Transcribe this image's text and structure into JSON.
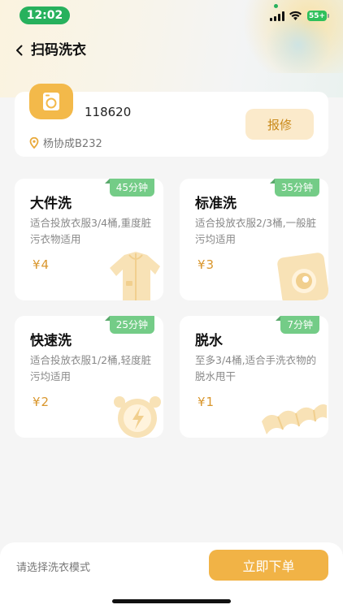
{
  "status_bar": {
    "time": "12:02",
    "battery": "55+"
  },
  "header": {
    "title": "扫码洗衣"
  },
  "device": {
    "id": "118620",
    "location": "杨协成B232",
    "repair_label": "报修"
  },
  "modes": [
    {
      "name": "大件洗",
      "duration": "45分钟",
      "desc": "适合投放衣服3/4桶,重度脏污衣物适用",
      "price": "¥4",
      "icon": "jacket-icon"
    },
    {
      "name": "标准洗",
      "duration": "35分钟",
      "desc": "适合投放衣服2/3桶,一般脏污均适用",
      "price": "¥3",
      "icon": "washing-machine-icon"
    },
    {
      "name": "快速洗",
      "duration": "25分钟",
      "desc": "适合投放衣服1/2桶,轻度脏污均适用",
      "price": "¥2",
      "icon": "alarm-clock-icon"
    },
    {
      "name": "脱水",
      "duration": "7分钟",
      "desc": "至多3/4桶,适合手洗衣物的脱水甩干",
      "price": "¥1",
      "icon": "twisted-towel-icon"
    }
  ],
  "footer": {
    "hint": "请选择洗衣模式",
    "order_label": "立即下单"
  },
  "colors": {
    "accent": "#f1b346",
    "badge": "#74cc87",
    "price": "#d9962c",
    "status_pill": "#27b15d"
  }
}
